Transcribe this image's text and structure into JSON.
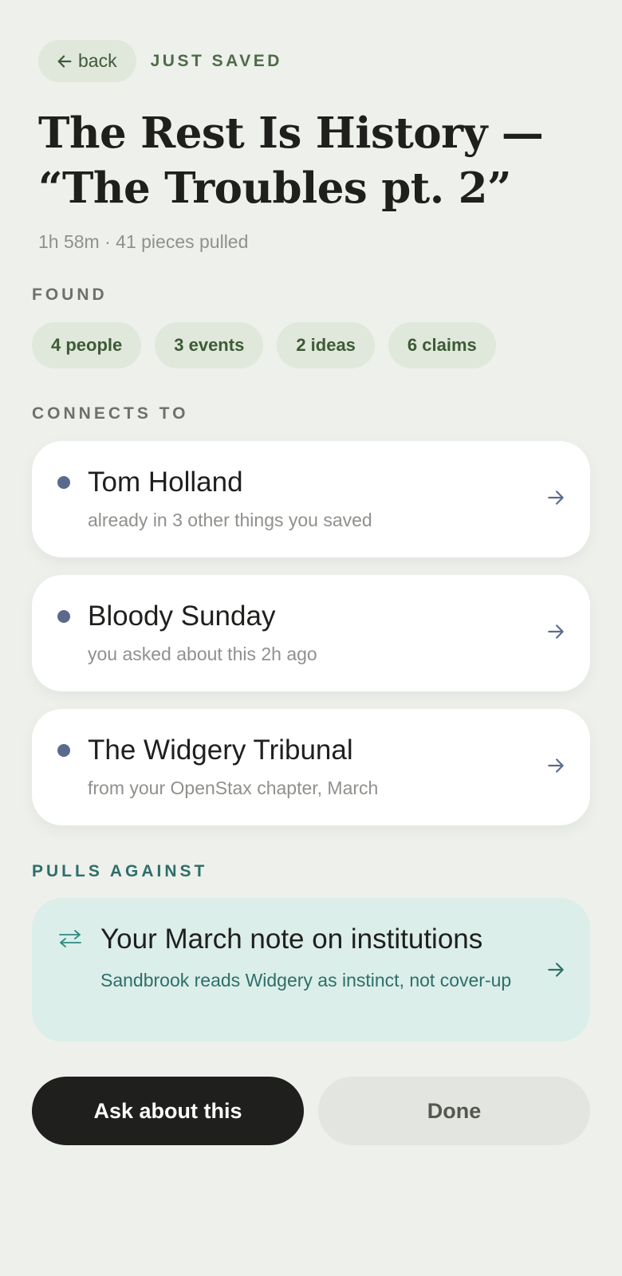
{
  "header": {
    "back_label": "back",
    "status": "JUST SAVED"
  },
  "item": {
    "title": "The Rest Is History — “The Troubles pt. 2”",
    "meta": "1h 58m · 41 pieces pulled"
  },
  "found": {
    "label": "FOUND",
    "chips": [
      "4 people",
      "3 events",
      "2 ideas",
      "6 claims"
    ]
  },
  "connects": {
    "label": "CONNECTS TO",
    "items": [
      {
        "title": "Tom Holland",
        "sub": "already in 3 other things you saved"
      },
      {
        "title": "Bloody Sunday",
        "sub": "you asked about this 2h ago"
      },
      {
        "title": "The Widgery Tribunal",
        "sub": "from your OpenStax chapter, March"
      }
    ]
  },
  "pulls_against": {
    "label": "PULLS AGAINST",
    "title": "Your March note on institutions",
    "sub": "Sandbrook reads Widgery as instinct, not cover-up"
  },
  "actions": {
    "ask_label": "Ask about this",
    "done_label": "Done"
  },
  "icons": {
    "back": "arrow-left-icon",
    "row_arrow": "arrow-right-icon",
    "contrast": "swap-arrows-icon"
  },
  "colors": {
    "background": "#eef0ec",
    "accent_green": "#4f6b48",
    "chip_bg": "#dfe8da",
    "dot": "#5b6a8c",
    "teal": "#2e6e69",
    "contrast_bg": "#dbeee9",
    "primary_button": "#1f1f1d"
  }
}
